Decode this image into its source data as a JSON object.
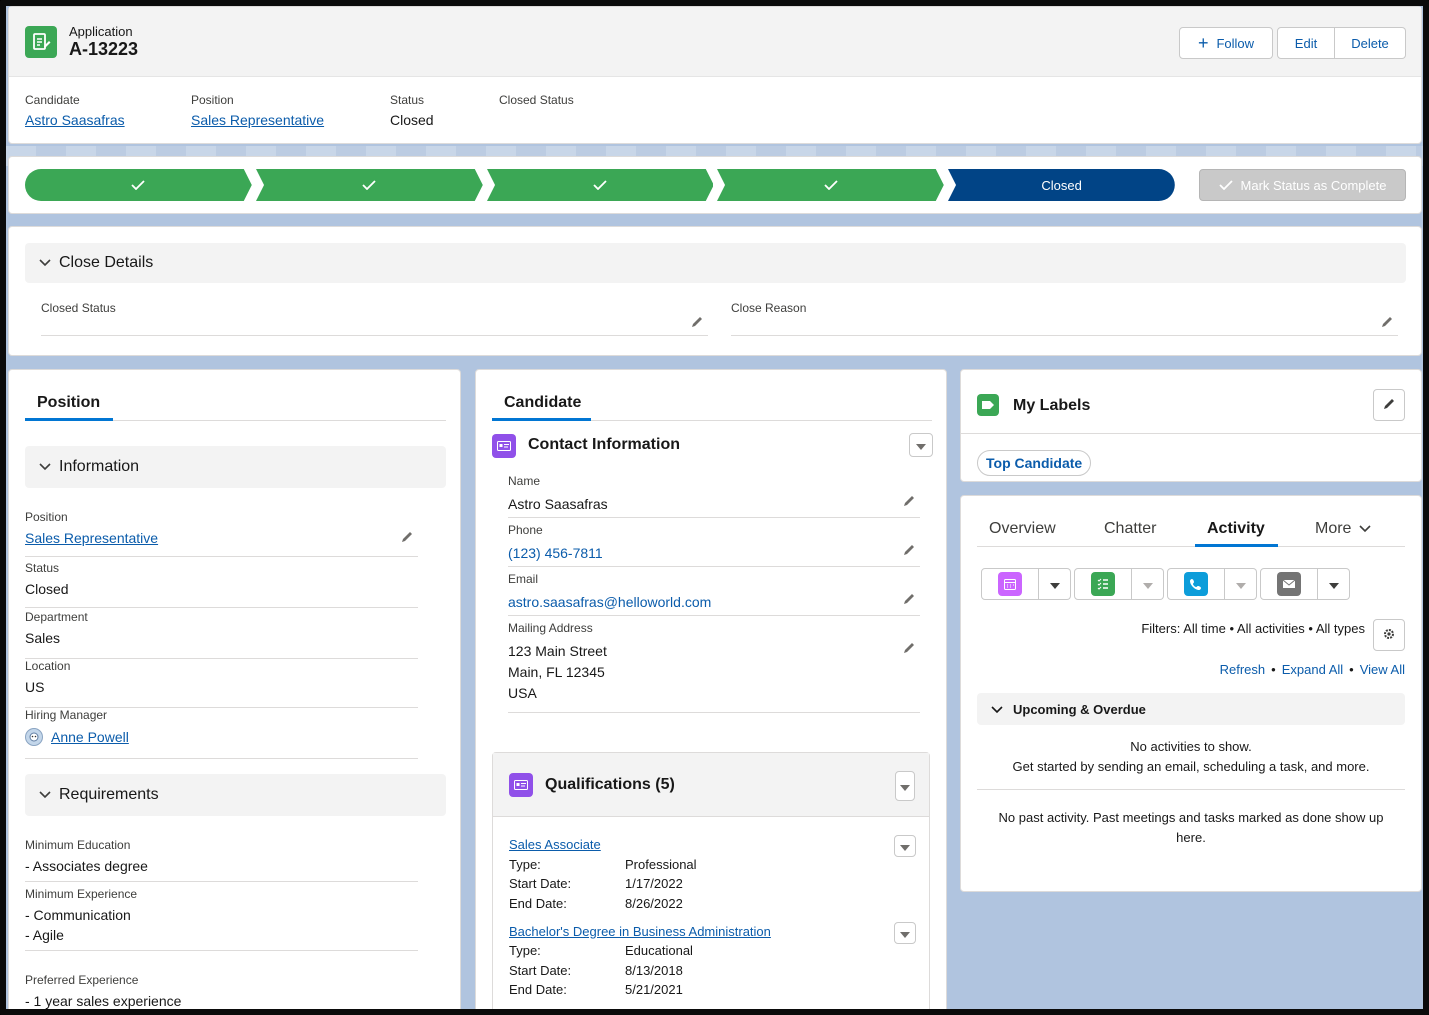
{
  "header": {
    "object_label": "Application",
    "record_name": "A-13223",
    "follow_label": "Follow",
    "edit_label": "Edit",
    "delete_label": "Delete",
    "highlights": [
      {
        "label": "Candidate",
        "value": "Astro Saasafras",
        "is_link": true
      },
      {
        "label": "Position",
        "value": "Sales Representative",
        "is_link": true
      },
      {
        "label": "Status",
        "value": "Closed",
        "is_link": false
      },
      {
        "label": "Closed Status",
        "value": "",
        "is_link": false
      }
    ]
  },
  "path": {
    "stages": [
      "",
      "",
      "",
      "",
      "Closed"
    ],
    "completed_count": 4,
    "mark_complete_label": "Mark Status as Complete",
    "colors": {
      "complete": "#3ba755",
      "current": "#014486",
      "disabled": "#c9c9c9"
    }
  },
  "close_details": {
    "title": "Close Details",
    "fields": [
      {
        "label": "Closed Status",
        "value": ""
      },
      {
        "label": "Close Reason",
        "value": ""
      }
    ]
  },
  "position_tab": {
    "tab_label": "Position",
    "information": {
      "title": "Information",
      "fields": [
        {
          "label": "Position",
          "value": "Sales Representative"
        },
        {
          "label": "Status",
          "value": "Closed"
        },
        {
          "label": "Department",
          "value": "Sales"
        },
        {
          "label": "Location",
          "value": "US"
        },
        {
          "label": "Hiring Manager",
          "value": "Anne Powell"
        }
      ]
    },
    "requirements": {
      "title": "Requirements",
      "fields": [
        {
          "label": "Minimum Education",
          "lines": [
            "- Associates degree"
          ]
        },
        {
          "label": "Minimum Experience",
          "lines": [
            "- Communication",
            "- Agile"
          ]
        },
        {
          "label": "Preferred Experience",
          "lines": [
            "- 1 year sales experience"
          ]
        }
      ]
    }
  },
  "candidate_tab": {
    "tab_label": "Candidate",
    "contact": {
      "title": "Contact Information",
      "fields": [
        {
          "label": "Name",
          "value": "Astro Saasafras"
        },
        {
          "label": "Phone",
          "value": "(123) 456-7811"
        },
        {
          "label": "Email",
          "value": "astro.saasafras@helloworld.com"
        },
        {
          "label": "Mailing Address",
          "lines": [
            "123 Main Street",
            "Main, FL 12345",
            "USA"
          ]
        }
      ]
    },
    "qualifications": {
      "title": "Qualifications (5)",
      "items": [
        {
          "name": "Sales Associate",
          "type_label": "Type:",
          "type": "Professional",
          "start_label": "Start Date:",
          "start": "1/17/2022",
          "end_label": "End Date:",
          "end": "8/26/2022"
        },
        {
          "name": "Bachelor's Degree in Business Administration",
          "type_label": "Type:",
          "type": "Educational",
          "start_label": "Start Date:",
          "start": "8/13/2018",
          "end_label": "End Date:",
          "end": "5/21/2021"
        }
      ]
    }
  },
  "labels": {
    "title": "My Labels",
    "items": [
      "Top Candidate"
    ]
  },
  "activity": {
    "tabs": [
      "Overview",
      "Chatter",
      "Activity",
      "More"
    ],
    "active_tab": "Activity",
    "filters_text": "Filters: All time • All activities • All types",
    "refresh_label": "Refresh",
    "expand_all_label": "Expand All",
    "view_all_label": "View All",
    "sep": "•",
    "upcoming_title": "Upcoming & Overdue",
    "no_activities": "No activities to show.",
    "get_started": "Get started by sending an email, scheduling a task, and more.",
    "no_past": "No past activity. Past meetings and tasks marked as done show up here.",
    "action_icons": [
      {
        "name": "event-icon",
        "color": "#cb65ff"
      },
      {
        "name": "task-icon",
        "color": "#3ba755"
      },
      {
        "name": "log-call-icon",
        "color": "#0d9dda"
      },
      {
        "name": "email-icon",
        "color": "#747474"
      }
    ]
  }
}
